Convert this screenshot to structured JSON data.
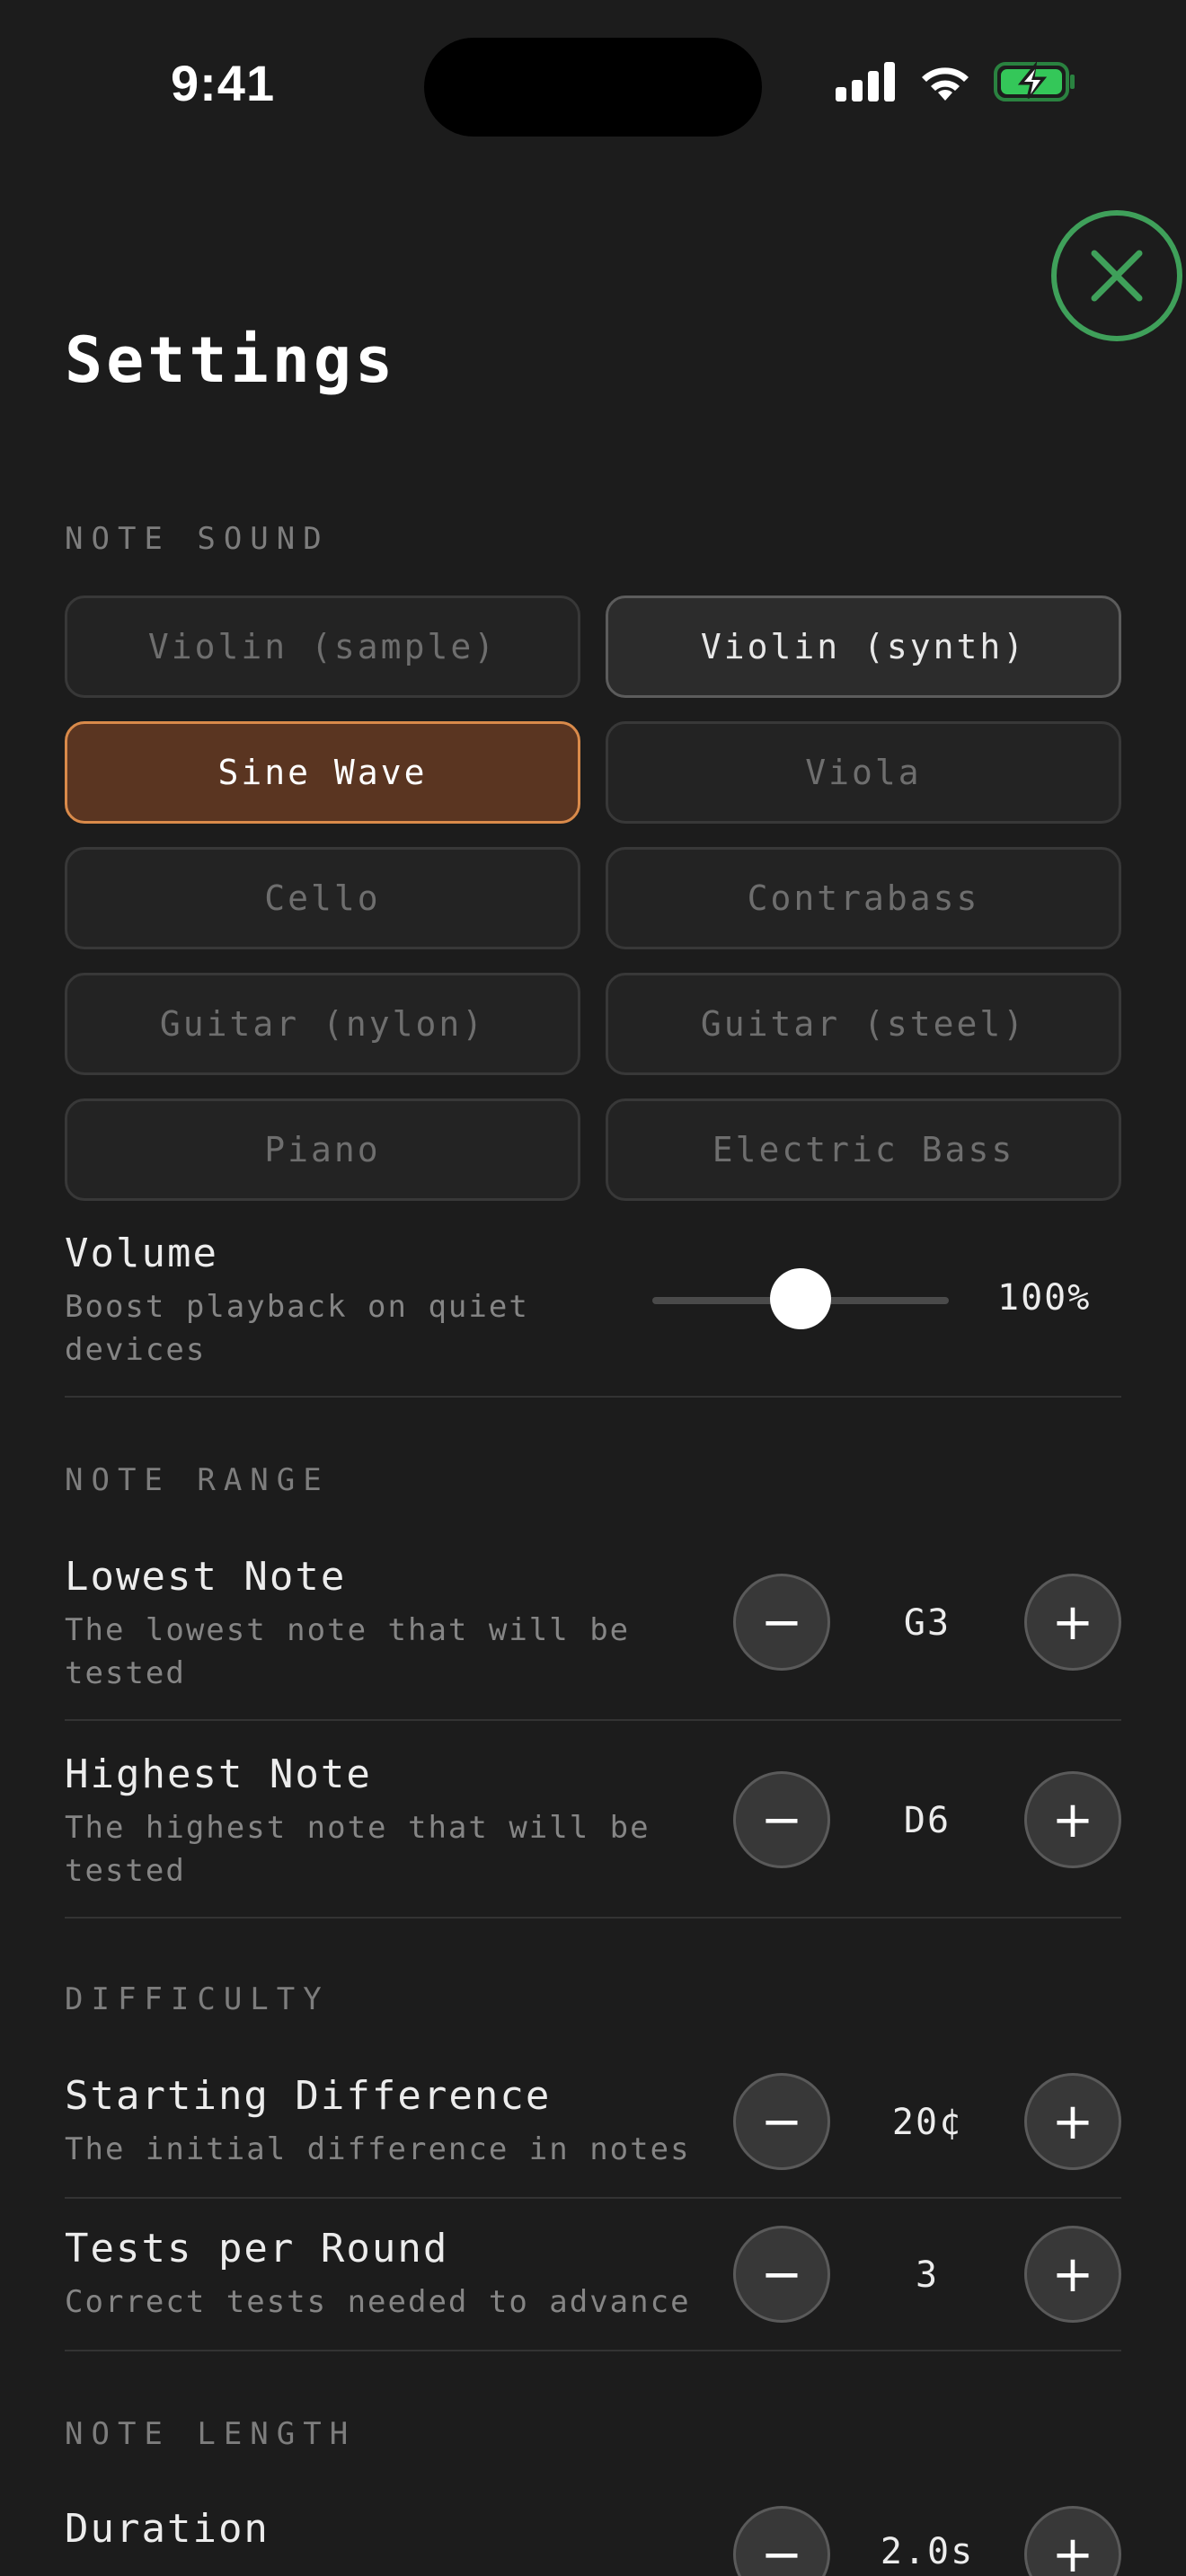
{
  "status_bar": {
    "time": "9:41"
  },
  "page": {
    "title": "Settings"
  },
  "sections": {
    "note_sound": "NOTE SOUND",
    "note_range": "NOTE RANGE",
    "difficulty": "DIFFICULTY",
    "note_length": "NOTE LENGTH"
  },
  "sounds": [
    {
      "label": "Violin (sample)",
      "state": "default"
    },
    {
      "label": "Violin (synth)",
      "state": "secondary"
    },
    {
      "label": "Sine Wave",
      "state": "selected"
    },
    {
      "label": "Viola",
      "state": "default"
    },
    {
      "label": "Cello",
      "state": "default"
    },
    {
      "label": "Contrabass",
      "state": "default"
    },
    {
      "label": "Guitar (nylon)",
      "state": "default"
    },
    {
      "label": "Guitar (steel)",
      "state": "default"
    },
    {
      "label": "Piano",
      "state": "default"
    },
    {
      "label": "Electric Bass",
      "state": "default"
    }
  ],
  "volume": {
    "label": "Volume",
    "description": "Boost playback on quiet devices",
    "value_text": "100%",
    "slider_fraction": 0.5
  },
  "lowest_note": {
    "label": "Lowest Note",
    "description": "The lowest note that will be tested",
    "value": "G3"
  },
  "highest_note": {
    "label": "Highest Note",
    "description": "The highest note that will be tested",
    "value": "D6"
  },
  "starting_difference": {
    "label": "Starting Difference",
    "description": "The initial difference in notes",
    "value": "20¢"
  },
  "tests_per_round": {
    "label": "Tests per Round",
    "description": "Correct tests needed to advance",
    "value": "3"
  },
  "duration": {
    "label": "Duration",
    "value": "2.0s"
  },
  "stepper": {
    "minus": "−",
    "plus": "+"
  },
  "colors": {
    "accent": "#d98a4a",
    "selected_bg": "#5a3521",
    "close": "#3fa05a",
    "battery": "#34c759"
  }
}
